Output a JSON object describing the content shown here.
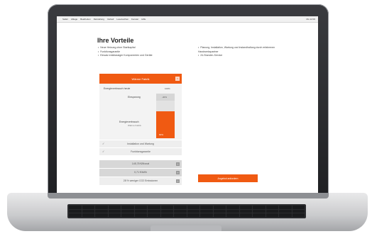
{
  "menubar": {
    "apple": "",
    "items": [
      "Safari",
      "Ablage",
      "Bearbeiten",
      "Darstellung",
      "Verlauf",
      "Lesezeichen",
      "Fenster",
      "Hilfe"
    ],
    "right": "Mo 12:00"
  },
  "page": {
    "title": "Ihre Vorteile",
    "bullets_left": [
      "Neue Heizung ohne Startkapital",
      "Funktionsgarantie",
      "Einsatz erstklassiger Komponenten und Geräte"
    ],
    "bullets_right": [
      "Planung, Installation, Wartung und Instandhaltung durch erfahrenen Handwerkspartner",
      "24-Stunden-Service"
    ]
  },
  "panel": {
    "header": "Wärme Fabrik",
    "header_icon": "close-icon",
    "energy_today_label": "Energieverbrauch heute",
    "energy_today_pct": "100%",
    "savings_label": "Einsparung",
    "savings_pct": "-40%",
    "energy_future_label": "Energieverbrauch",
    "energy_future_sub": "Wärme Fabrik",
    "energy_future_pct": "60%",
    "energy_future_fraction": 0.6,
    "checks": [
      {
        "label": "Installation und Wartung"
      },
      {
        "label": "Funktionsgarantie"
      }
    ],
    "sums": [
      {
        "label": "145,78 €/Monat",
        "style": "dark"
      },
      {
        "label": "0,71 €/kWh",
        "style": "dark"
      },
      {
        "label": "28 % weniger CO2 Emissionen",
        "style": "light"
      }
    ]
  },
  "cta": {
    "label": "Angebot anfordern"
  },
  "colors": {
    "accent": "#f05a12",
    "panel_bg": "#f3f3f3",
    "row_dark": "#d7d7d7"
  }
}
